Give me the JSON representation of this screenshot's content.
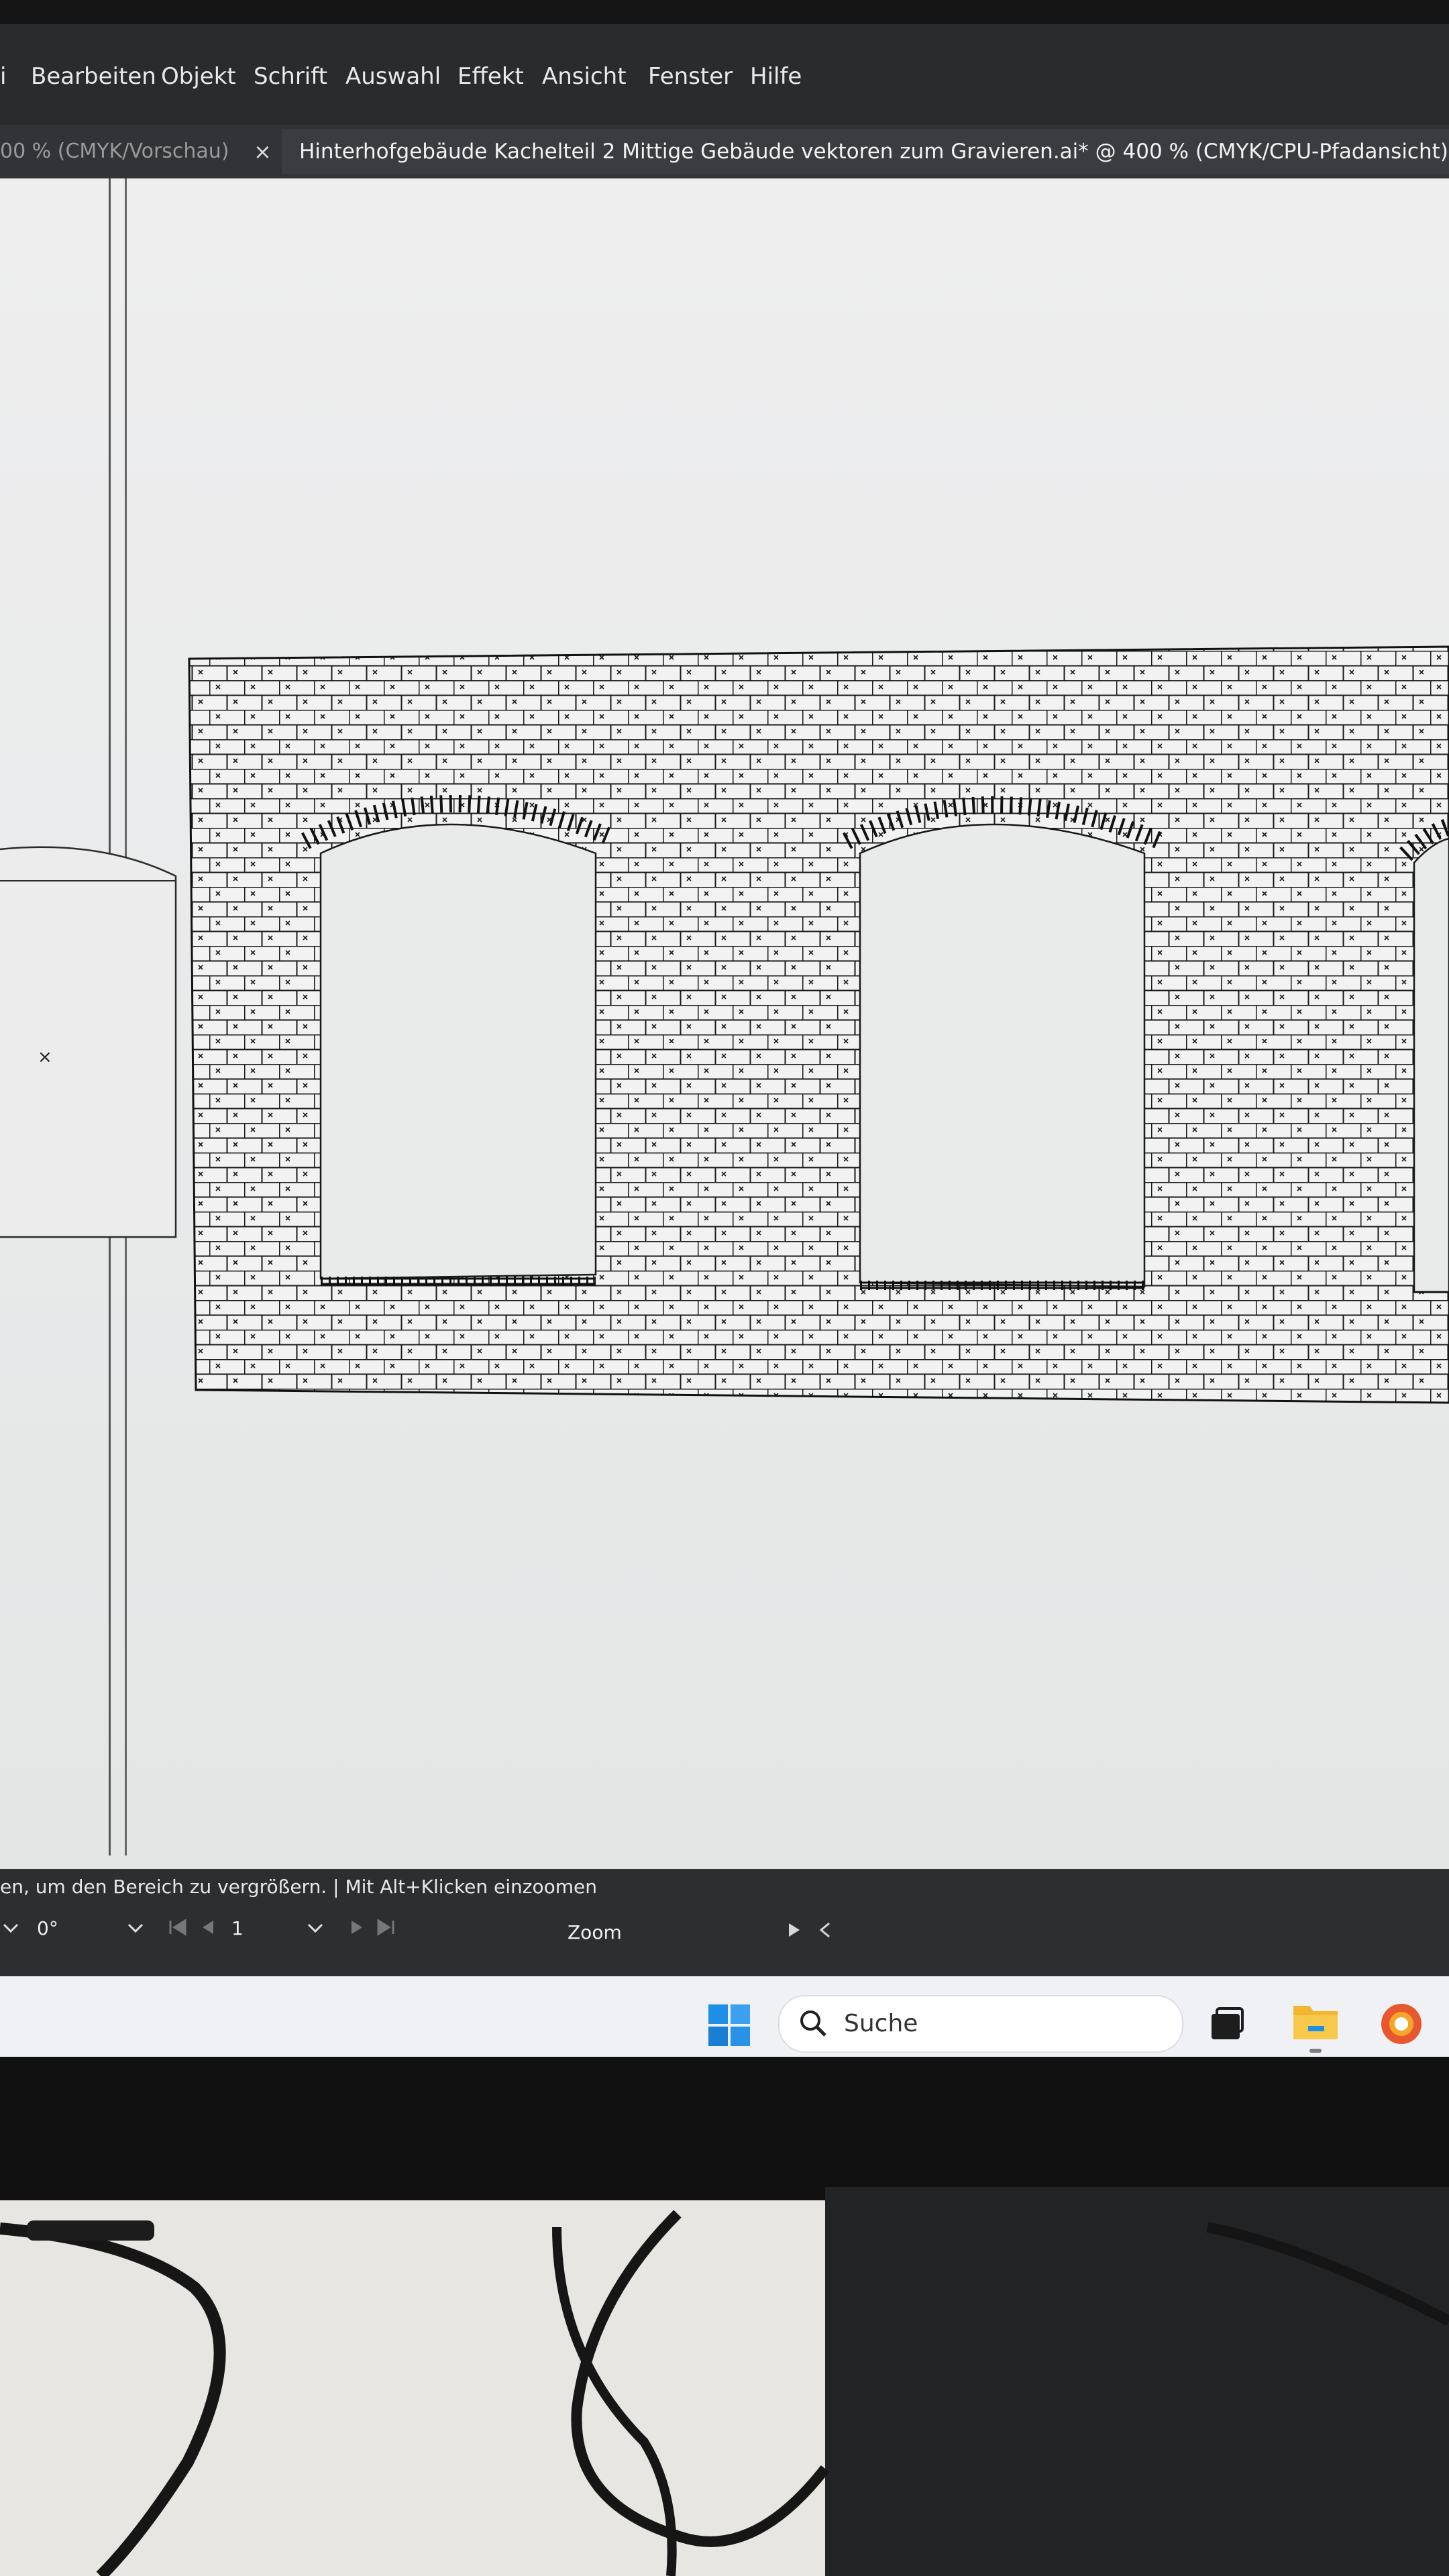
{
  "menu": {
    "items": [
      "i",
      "Bearbeiten",
      "Objekt",
      "Schrift",
      "Auswahl",
      "Effekt",
      "Ansicht",
      "Fenster",
      "Hilfe"
    ]
  },
  "tabs": {
    "inactive_label": "00 % (CMYK/Vorschau)",
    "close_symbol": "×",
    "active_label": "Hinterhofgebäude Kachelteil 2 Mittige Gebäude vektoren zum Gravieren.ai* @ 400 % (CMYK/CPU-Pfadansicht)"
  },
  "status": {
    "message": "en, um den Bereich zu vergrößern.  |  Mit Alt+Klicken einzoomen",
    "rotation": "0°",
    "page": "1",
    "zoom_label": "Zoom"
  },
  "taskbar": {
    "search_placeholder": "Suche"
  },
  "colors": {
    "ui_dark": "#2a2b2d",
    "canvas": "#e9eaea",
    "path_stroke": "#1a1a1a",
    "taskbar": "#f0f1f4",
    "windows_blue": "#1f8ee6",
    "folder_yellow": "#f2b631"
  }
}
